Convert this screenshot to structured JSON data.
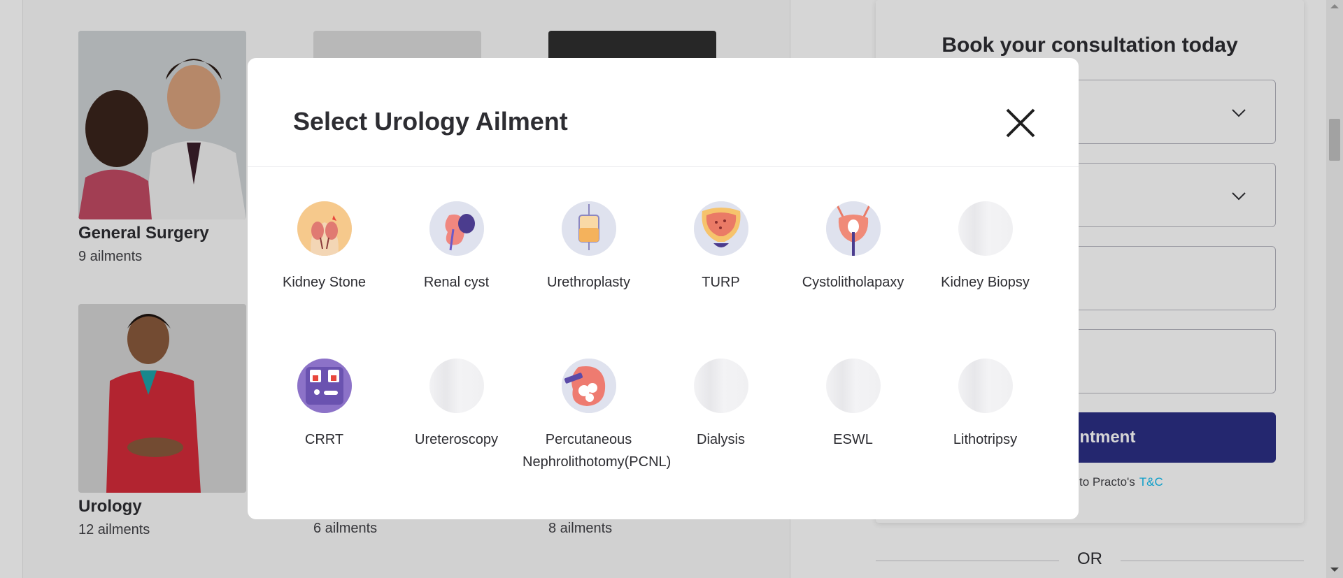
{
  "background": {
    "cards": [
      {
        "title": "General Surgery",
        "count": "9 ailments"
      },
      {
        "title": "Urology",
        "count": "12 ailments"
      }
    ],
    "partial_counts": [
      "6 ailments",
      "8 ailments"
    ]
  },
  "booking": {
    "title": "Book your consultation today",
    "button_label": "ppointment",
    "terms_text": ", you agree to Practo's",
    "terms_link": "T&C",
    "or_text": "OR"
  },
  "modal": {
    "title": "Select Urology Ailment",
    "close_icon": "close-icon",
    "ailments": [
      {
        "label": "Kidney Stone",
        "icon": "kidney-stone-icon"
      },
      {
        "label": "Renal cyst",
        "icon": "renal-cyst-icon"
      },
      {
        "label": "Urethroplasty",
        "icon": "urine-bag-icon"
      },
      {
        "label": "TURP",
        "icon": "bladder-icon"
      },
      {
        "label": "Cystolitholapaxy",
        "icon": "bladder-catheter-icon"
      },
      {
        "label": "Kidney Biopsy",
        "icon": "placeholder-icon"
      },
      {
        "label": "CRRT",
        "icon": "dialysis-machine-icon"
      },
      {
        "label": "Ureteroscopy",
        "icon": "placeholder-icon"
      },
      {
        "label": "Percutaneous Nephrolithotomy(PCNL)",
        "icon": "kidney-stones-icon"
      },
      {
        "label": "Dialysis",
        "icon": "placeholder-icon"
      },
      {
        "label": "ESWL",
        "icon": "placeholder-icon"
      },
      {
        "label": "Lithotripsy",
        "icon": "placeholder-icon"
      }
    ]
  },
  "colors": {
    "primary_button": "#2c2f85",
    "link": "#14bef0",
    "text": "#2d2d32"
  }
}
